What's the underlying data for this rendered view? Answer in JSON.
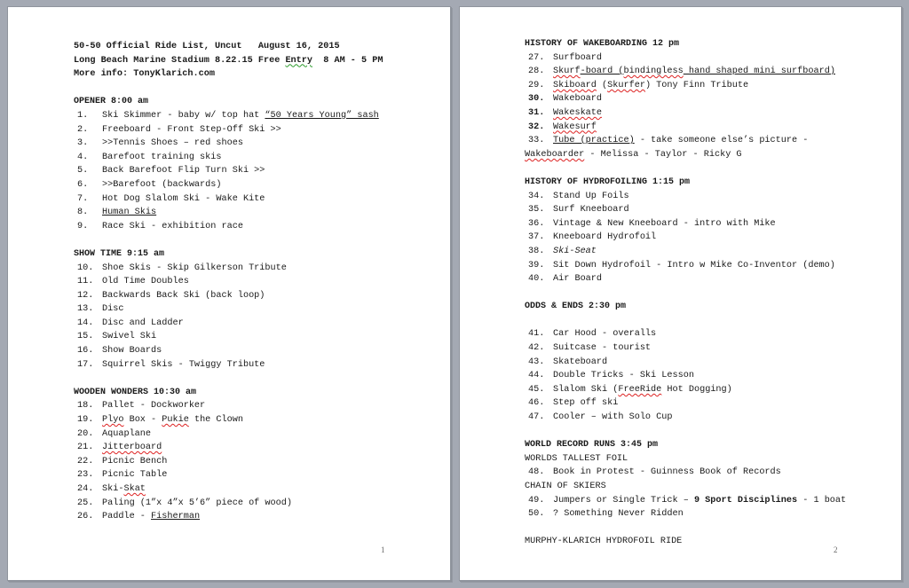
{
  "document": {
    "pages": [
      {
        "page_number": "1",
        "header": {
          "title_line": "50-50 Official Ride List, Uncut   August 16, 2015",
          "venue_line_before": "Long Beach Marine Stadium 8.22.15 Free ",
          "venue_line_flagged": "Entry",
          "venue_line_after": "  8 AM - 5 PM",
          "info_line": "More info: TonyKlarich.com"
        },
        "sections": [
          {
            "heading": "OPENER 8:00 am",
            "items": [
              {
                "num": "1.",
                "text": "Ski Skimmer - baby w/ top hat ",
                "underlined": "“50 Years Young” sash"
              },
              {
                "num": "2.",
                "text": "Freeboard - Front Step-Off Ski >>"
              },
              {
                "num": "3.",
                "text": ">>Tennis Shoes – red shoes"
              },
              {
                "num": "4.",
                "text": "Barefoot training skis"
              },
              {
                "num": "5.",
                "text": "Back Barefoot Flip Turn Ski >>"
              },
              {
                "num": "6.",
                "text": ">>Barefoot (backwards)"
              },
              {
                "num": "7.",
                "text": "Hot Dog Slalom Ski - Wake Kite"
              },
              {
                "num": "8.",
                "underlined": "Human Skis"
              },
              {
                "num": "9.",
                "text": "Race Ski - exhibition race"
              }
            ]
          },
          {
            "heading": "SHOW TIME 9:15 am",
            "items": [
              {
                "num": "10.",
                "text": "Shoe Skis - Skip Gilkerson Tribute"
              },
              {
                "num": "11.",
                "text": "Old Time Doubles"
              },
              {
                "num": "12.",
                "text": "Backwards Back Ski (back loop)"
              },
              {
                "num": "13.",
                "text": "Disc"
              },
              {
                "num": "14.",
                "text": "Disc and Ladder"
              },
              {
                "num": "15.",
                "text": "Swivel Ski"
              },
              {
                "num": "16.",
                "text": "Show Boards"
              },
              {
                "num": "17.",
                "text": "Squirrel Skis - Twiggy Tribute"
              }
            ]
          },
          {
            "heading": "WOODEN WONDERS 10:30 am",
            "items": [
              {
                "num": "18.",
                "text": "Pallet - Dockworker"
              },
              {
                "num": "19.",
                "parts": [
                  {
                    "t": "Plyo",
                    "s": "sp"
                  },
                  {
                    "t": " Box - "
                  },
                  {
                    "t": "Pukie",
                    "s": "sp"
                  },
                  {
                    "t": " the Clown"
                  }
                ]
              },
              {
                "num": "20.",
                "text": "Aquaplane"
              },
              {
                "num": "21.",
                "parts": [
                  {
                    "t": "Jitterboard",
                    "s": "u sp"
                  }
                ]
              },
              {
                "num": "22.",
                "text": "Picnic Bench"
              },
              {
                "num": "23.",
                "text": "Picnic Table"
              },
              {
                "num": "24.",
                "parts": [
                  {
                    "t": "Ski-"
                  },
                  {
                    "t": "Skat",
                    "s": "sp"
                  }
                ]
              },
              {
                "num": "25.",
                "text": "Paling (1”x 4”x 5’6” piece of wood)"
              },
              {
                "num": "26.",
                "parts": [
                  {
                    "t": "Paddle - "
                  },
                  {
                    "t": "Fisherman",
                    "s": "u"
                  }
                ]
              }
            ]
          }
        ]
      },
      {
        "page_number": "2",
        "sections": [
          {
            "heading": "HISTORY OF WAKEBOARDING 12 pm",
            "items": [
              {
                "num": "27.",
                "text": "Surfboard"
              },
              {
                "num": "28.",
                "parts": [
                  {
                    "t": "Skurf",
                    "s": "u sp"
                  },
                  {
                    "t": "-board (",
                    "s": "u"
                  },
                  {
                    "t": "bindingless",
                    "s": "u sp"
                  },
                  {
                    "t": " hand shaped mini surfboard)",
                    "s": "u"
                  }
                ]
              },
              {
                "num": "29.",
                "parts": [
                  {
                    "t": "Skiboard",
                    "s": "u sp"
                  },
                  {
                    "t": " ("
                  },
                  {
                    "t": "Skurfer",
                    "s": "sp"
                  },
                  {
                    "t": ") Tony Finn Tribute"
                  }
                ]
              },
              {
                "num": "30.",
                "bold_num": true,
                "text": "Wakeboard"
              },
              {
                "num": "31.",
                "bold_num": true,
                "parts": [
                  {
                    "t": "Wakeskate",
                    "s": "sp"
                  }
                ]
              },
              {
                "num": "32.",
                "bold_num": true,
                "parts": [
                  {
                    "t": "Wakesurf",
                    "s": "sp"
                  }
                ]
              },
              {
                "num": "33.",
                "parts": [
                  {
                    "t": "Tube (practice)",
                    "s": "u"
                  },
                  {
                    "t": " - take someone else’s picture -"
                  }
                ],
                "continuation": [
                  {
                    "t": "Wakeboarder",
                    "s": "sp"
                  },
                  {
                    "t": " - Melissa - Taylor - Ricky G"
                  }
                ]
              }
            ]
          },
          {
            "heading": "HISTORY OF HYDROFOILING 1:15 pm",
            "items": [
              {
                "num": "34.",
                "text": "Stand Up Foils"
              },
              {
                "num": "35.",
                "text": "Surf Kneeboard"
              },
              {
                "num": "36.",
                "text": "Vintage & New Kneeboard - intro with Mike"
              },
              {
                "num": "37.",
                "text": "Kneeboard Hydrofoil"
              },
              {
                "num": "38.",
                "parts": [
                  {
                    "t": "Ski-Seat",
                    "s": "it"
                  }
                ]
              },
              {
                "num": "39.",
                "text": "Sit Down Hydrofoil - Intro w Mike Co-Inventor (demo)"
              },
              {
                "num": "40.",
                "text": "Air Board"
              }
            ]
          },
          {
            "heading": "ODDS & ENDS 2:30 pm",
            "blank_after_heading": true,
            "items": [
              {
                "num": "41.",
                "text": "Car Hood - overalls"
              },
              {
                "num": "42.",
                "text": "Suitcase - tourist"
              },
              {
                "num": "43.",
                "text": "Skateboard"
              },
              {
                "num": "44.",
                "text": "Double Tricks - Ski Lesson"
              },
              {
                "num": "45.",
                "parts": [
                  {
                    "t": "Slalom Ski ("
                  },
                  {
                    "t": "FreeRide",
                    "s": "sp"
                  },
                  {
                    "t": " Hot Dogging)"
                  }
                ]
              },
              {
                "num": "46.",
                "text": "Step off ski"
              },
              {
                "num": "47.",
                "text": "Cooler – with Solo Cup"
              }
            ]
          },
          {
            "heading": "WORLD RECORD RUNS 3:45 pm",
            "subheading_1": "WORLDS TALLEST FOIL",
            "item_48": {
              "num": "48.",
              "text": "Book in Protest - Guinness Book of Records"
            },
            "subheading_2": "CHAIN OF SKIERS",
            "item_49": {
              "num": "49.",
              "parts": [
                {
                  "t": "Jumpers or Single Trick – "
                },
                {
                  "t": "9 Sport Disciplines",
                  "s": "bold"
                },
                {
                  "t": " - 1 boat"
                }
              ]
            },
            "item_50": {
              "num": "50.",
              "text": "? Something Never Ridden"
            }
          }
        ],
        "footer_line": "MURPHY-KLARICH HYDROFOIL RIDE"
      }
    ]
  }
}
